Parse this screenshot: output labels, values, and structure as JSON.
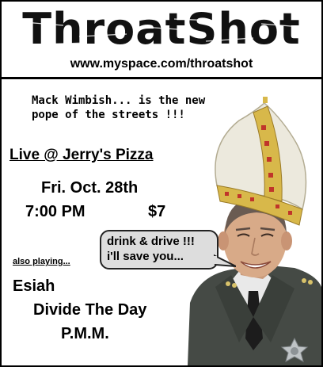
{
  "header": {
    "logo_text": "ThroatShot",
    "url": "www.myspace.com/throatshot"
  },
  "tagline": "Mack Wimbish... is the new\npope of the streets !!!",
  "event": {
    "title": "Live @ Jerry's Pizza",
    "date": "Fri. Oct. 28th",
    "time": "7:00 PM",
    "price": "$7"
  },
  "speech_bubble": {
    "text": "drink & drive !!!\ni'll save you..."
  },
  "also_playing": {
    "label": "also playing...",
    "bands": [
      "Esiah",
      "Divide The Day",
      "P.M.M."
    ]
  },
  "colors": {
    "background": "#ffffff",
    "border": "#000000",
    "bubble_fill": "#dddddd",
    "mitre_gold": "#c9a431",
    "uniform": "#454a45"
  },
  "icons": [
    "pope-mitre",
    "sheriff-star-badge"
  ]
}
